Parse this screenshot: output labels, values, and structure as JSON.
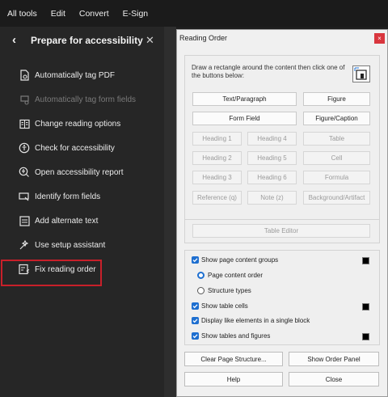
{
  "menubar": {
    "items": [
      "All tools",
      "Edit",
      "Convert",
      "E-Sign"
    ]
  },
  "panel": {
    "title": "Prepare for accessibility",
    "tools": [
      {
        "label": "Automatically tag PDF",
        "icon": "tag-document-icon",
        "enabled": true
      },
      {
        "label": "Automatically tag form fields",
        "icon": "tag-form-icon",
        "enabled": false
      },
      {
        "label": "Change reading options",
        "icon": "reading-options-icon",
        "enabled": true
      },
      {
        "label": "Check for accessibility",
        "icon": "accessibility-check-icon",
        "enabled": true
      },
      {
        "label": "Open accessibility report",
        "icon": "accessibility-report-icon",
        "enabled": true
      },
      {
        "label": "Identify form fields",
        "icon": "form-field-icon",
        "enabled": true
      },
      {
        "label": "Add alternate text",
        "icon": "alt-text-icon",
        "enabled": true
      },
      {
        "label": "Use setup assistant",
        "icon": "setup-assistant-icon",
        "enabled": true
      },
      {
        "label": "Fix reading order",
        "icon": "reading-order-icon",
        "enabled": true
      }
    ]
  },
  "dialog": {
    "title": "Reading Order",
    "close_glyph": "×",
    "instructions": "Draw a rectangle around the content then click one of the buttons below:",
    "tag_buttons": [
      [
        "Text/Paragraph",
        "Figure"
      ],
      [
        "Form Field",
        "Figure/Caption"
      ],
      [
        "Heading 1",
        "Heading 4",
        "Table"
      ],
      [
        "Heading 2",
        "Heading 5",
        "Cell"
      ],
      [
        "Heading 3",
        "Heading 6",
        "Formula"
      ],
      [
        "Reference (q)",
        "Note (z)",
        "Background/Artifact"
      ]
    ],
    "table_editor": "Table Editor",
    "options": {
      "show_page_content_groups": "Show page content groups",
      "page_content_order": "Page content order",
      "structure_types": "Structure types",
      "show_table_cells": "Show table cells",
      "display_like_elements": "Display like elements in a single block",
      "show_tables_and_figures": "Show tables and figures"
    },
    "buttons": {
      "clear": "Clear Page Structure...",
      "show_order": "Show Order Panel",
      "help": "Help",
      "close": "Close"
    }
  },
  "colors": {
    "accent": "#1e6fd0",
    "highlight": "#c8202a",
    "close_red": "#d9363e"
  }
}
